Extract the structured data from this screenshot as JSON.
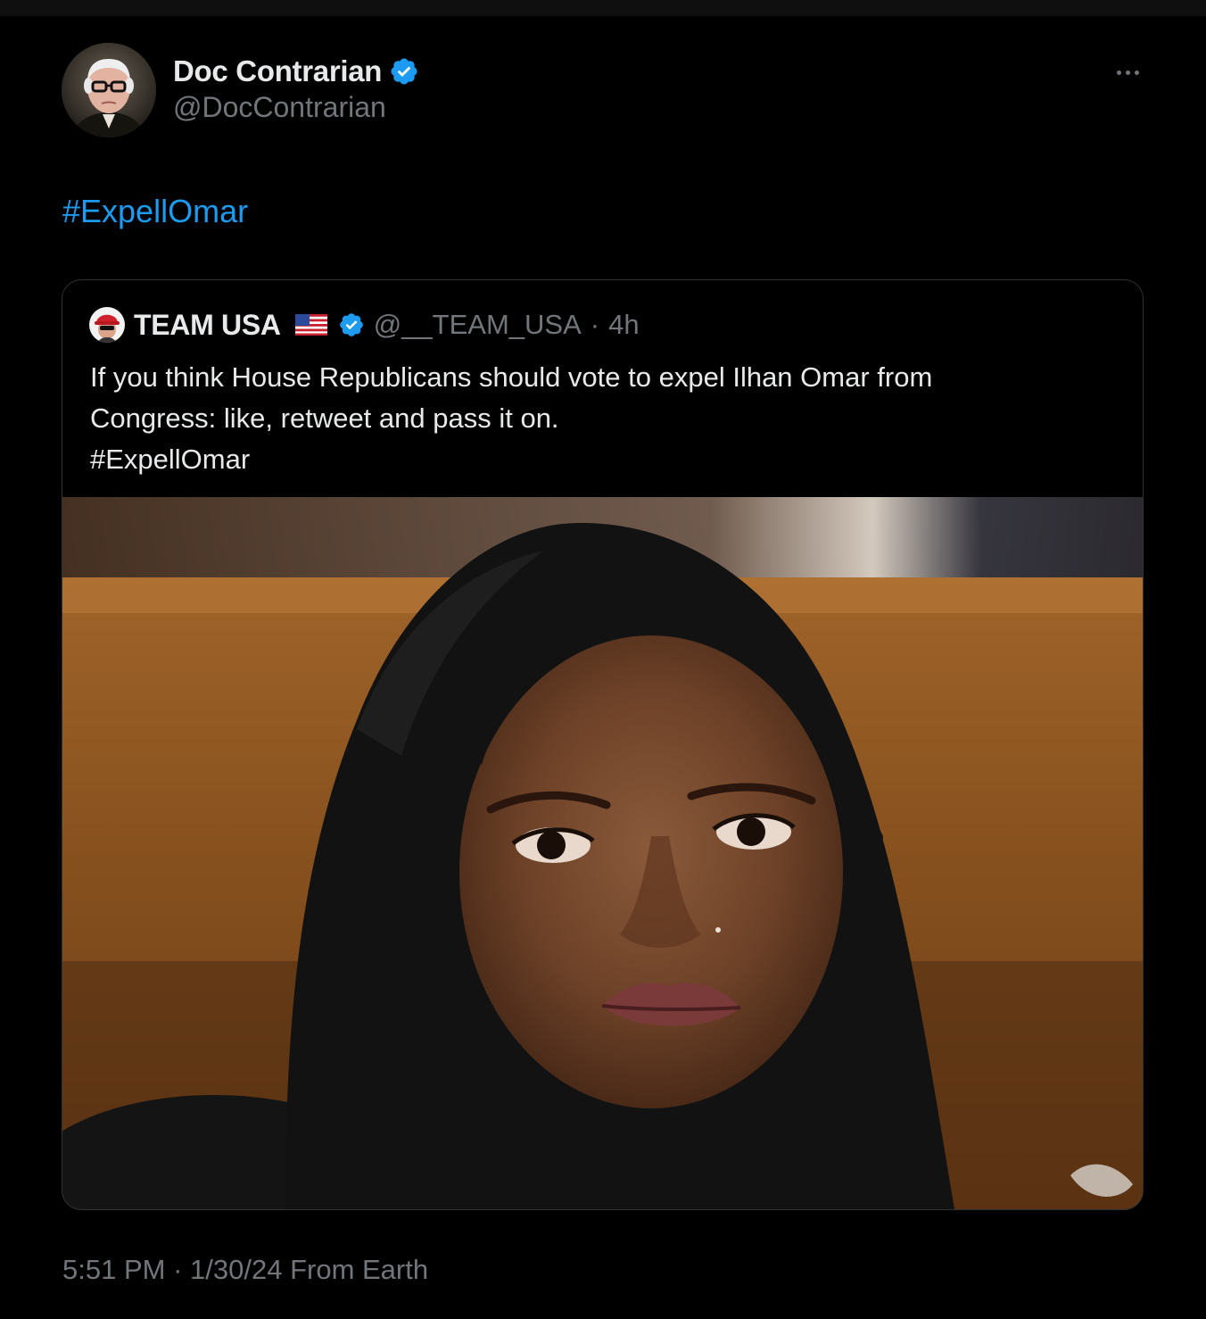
{
  "tweet": {
    "author": {
      "name": "Doc Contrarian",
      "handle": "@DocContrarian",
      "verified": true
    },
    "text": "#ExpellOmar",
    "quoted_tweet": {
      "author": {
        "name": "TEAM USA",
        "handle": "@__TEAM_USA",
        "verified": true,
        "flag": "us-flag-icon"
      },
      "separator": "·",
      "time": "4h",
      "text_lines": [
        "If you think House Republicans should vote to expel Ilhan Omar from",
        "Congress: like, retweet and pass it on.",
        "#ExpellOmar"
      ],
      "image": {
        "subject": "photo"
      }
    },
    "footer": {
      "time": "5:51 PM",
      "separator": " · ",
      "date": "1/30/24",
      "source": " From Earth"
    }
  },
  "colors": {
    "background": "#000000",
    "text_primary": "#e7e9ea",
    "text_secondary": "#71767b",
    "link": "#1d9bf0",
    "verified": "#1d9bf0",
    "border": "#2f3336"
  },
  "icons": [
    "verified-badge-icon",
    "more-options-icon",
    "us-flag-icon"
  ]
}
